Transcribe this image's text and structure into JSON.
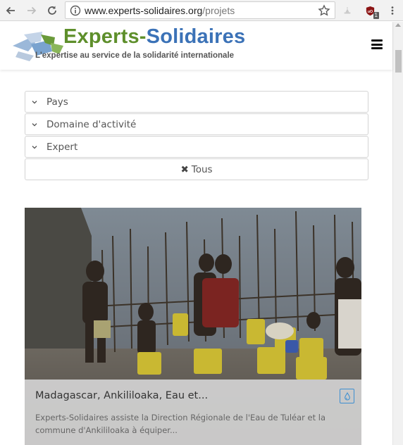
{
  "browser": {
    "url_host": "www.experts-solidaires.org",
    "url_path": "/projets",
    "extension_badge": "1"
  },
  "site": {
    "logo_part1": "Experts-",
    "logo_part2": "Solidaires",
    "tagline": "L'expertise au service de la solidarité internationale"
  },
  "filters": [
    {
      "label": "Pays"
    },
    {
      "label": "Domaine d'activité"
    },
    {
      "label": "Expert"
    }
  ],
  "reset_label": "Tous",
  "project": {
    "title": "Madagascar, Ankililoaka, Eau et...",
    "excerpt": "Experts-Solidaires assiste la Direction Régionale de l'Eau de Tuléar et la commune d'Ankililoaka à équiper...",
    "category_icon": "water-drop-icon"
  },
  "colors": {
    "logo_green": "#5e8f2b",
    "logo_blue": "#3b72b7",
    "water_icon": "#3d8fd1"
  }
}
